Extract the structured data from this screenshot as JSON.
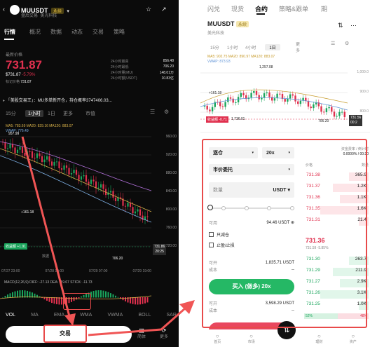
{
  "left": {
    "symbol": "MUUSDT",
    "tag": "永续",
    "sub1": "盘后交易",
    "sub2": "美光科技",
    "tabs": [
      "行情",
      "概况",
      "数据",
      "动态",
      "交易",
      "策略"
    ],
    "price_label": "最新价格",
    "price": "731.87",
    "price_usd": "$731.87",
    "change": "-5.79%",
    "mark_label": "标记价格",
    "mark_price": "731.87",
    "stats": [
      [
        "24小时最高",
        "856.48"
      ],
      [
        "24小时最低",
        "706.20"
      ],
      [
        "24小时量(MU)",
        "148.01万"
      ],
      [
        "24小时额(USDT)",
        "10.83亿"
      ]
    ],
    "notice": "「美股交易王」：MU多单新开仓，持仓概率3747406.03...",
    "intervals": [
      "15分",
      "1小时",
      "1日",
      "更多",
      "市值"
    ],
    "ma_line": "MA5: 783.69  MA20: 829.16  MA120: 883.07",
    "vwap_line": "VWAP: 776.49",
    "y_labels": [
      "960.00",
      "920.00",
      "880.00",
      "840.00",
      "800.00",
      "760.00",
      "720.00"
    ],
    "high_mark": "957.99",
    "low_mark": "706.20",
    "mid_mark": "+161.18",
    "tag_price": "731.86",
    "tag_time": "20:25",
    "pos_label": "收益额 +1.91",
    "pos_sub": "数据",
    "x_labels": [
      "07/27 23:00",
      "07/28 19:00",
      "07/29 07:00",
      "07/29 19:00"
    ],
    "macd_line": "MACD(12,26,9)  DIFF: -27.13  DEA: -19.67  STICK: -11.73",
    "indicators": [
      "VOL",
      "MA",
      "EMA",
      "WMA",
      "VWMA",
      "BOLL",
      "SAR"
    ],
    "trade_btn": "交易",
    "btm_icons": [
      "简体",
      "更多"
    ]
  },
  "right": {
    "tabs": [
      "闪兑",
      "现货",
      "合约",
      "策略&跟单",
      "期"
    ],
    "symbol": "MUUSDT",
    "tag": "永续",
    "sub": "美光科技",
    "intervals": [
      "15分",
      "1小时",
      "4小时",
      "1日",
      "更多"
    ],
    "ma_line": "MA5: 902.75  MA20: 890.97  MA120: 883.07",
    "vwap_line": "VWAP: 873.93",
    "high_mark": "1,257.08",
    "low_mark": "706.20",
    "mid_mark": "+161.18",
    "ref": "1,736.01",
    "y_labels": [
      "1,000.0",
      "900.0",
      "800.0"
    ],
    "tag_price": "731.56",
    "tag_time": "00:2",
    "pos_label": "收益额 -0.71",
    "margin_mode": "逐仓",
    "leverage": "20x",
    "order_type": "市价委托",
    "qty_label": "数量",
    "qty_unit": "USDT",
    "avail_label": "可用",
    "avail_val": "94.46 USDT",
    "reduce": "只减仓",
    "tpsl": "止盈/止损",
    "can_open_label": "可开",
    "can_open": "1,835.71 USDT",
    "cost_label": "成本",
    "cost": "--",
    "buy_btn": "买入 (做多) 20x",
    "can_open2": "3,598.29 USDT",
    "cost2": "--",
    "fund_label": "资金费率 / 倒计时",
    "fund_val": "0.0000% / 00:20",
    "ob_head": [
      "价格",
      "数量"
    ],
    "asks": [
      [
        "731.38",
        "365.9"
      ],
      [
        "731.37",
        "1.2K"
      ],
      [
        "731.36",
        "1.1K"
      ],
      [
        "731.35",
        "1.6K"
      ],
      [
        "731.31",
        "21.4"
      ]
    ],
    "mid": "731.36",
    "mid_sub": "731.59 -5.85%",
    "bids": [
      [
        "731.30",
        "263.7"
      ],
      [
        "731.29",
        "211.9"
      ],
      [
        "731.27",
        "2.9K"
      ],
      [
        "731.26",
        "3.1K"
      ],
      [
        "731.25",
        "1.0K"
      ]
    ],
    "bid_pct": "52%",
    "ask_pct": "48%",
    "bottom_nav": [
      "首页",
      "市场",
      "交易",
      "理财",
      "资产"
    ]
  }
}
